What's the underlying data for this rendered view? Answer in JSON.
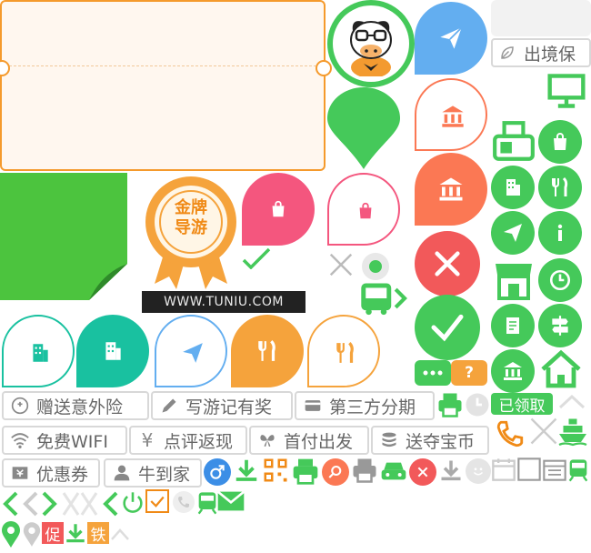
{
  "watermark": {
    "url": "WWW.TUNIU.COM"
  },
  "medal": {
    "line1": "金牌",
    "line2": "导游"
  },
  "badges": {
    "out_of_country": "出境保",
    "received": "已领取",
    "promo": "促",
    "special": "铁"
  },
  "tags": {
    "gift_insurance": "赠送意外险",
    "write_travel_notes": "写游记有奖",
    "third_party_installment": "第三方分期",
    "free_wifi": "免费WIFI",
    "review_cashback": "点评返现",
    "first_payment_departure": "首付出发",
    "treasure_coins": "送夺宝币",
    "coupons": "优惠券",
    "niu_arrival": "牛到家"
  },
  "colors": {
    "green": "#45c95a",
    "teal": "#19c1a0",
    "orange": "#f5a33c",
    "coral": "#fb7854",
    "pink": "#f4567e",
    "blue": "#63aef0",
    "red": "#f2595a",
    "ticket_border": "#f59a2c"
  },
  "icons": [
    "mascot-cow-icon",
    "paper-plane-icon",
    "shopping-bag-icon",
    "bank-icon",
    "building-icon",
    "fork-knife-icon",
    "close-icon",
    "check-icon",
    "info-icon",
    "clock-icon",
    "document-icon",
    "signpost-icon",
    "home-icon",
    "shop-icon",
    "fax-icon",
    "monitor-icon",
    "bus-icon",
    "gift-icon",
    "pen-icon",
    "card-icon",
    "printer-icon",
    "wifi-icon",
    "yen-icon",
    "butterfly-icon",
    "coins-icon",
    "ticket-icon",
    "user-icon",
    "male-icon",
    "download-icon",
    "qrcode-icon",
    "search-icon",
    "car-icon",
    "smile-icon",
    "calendar-icon",
    "train-icon",
    "mail-icon",
    "phone-icon",
    "ship-icon",
    "location-icon",
    "chevron-left-icon",
    "chevron-right-icon",
    "power-icon",
    "checkbox-icon",
    "question-icon",
    "chat-icon",
    "leaf-icon"
  ]
}
